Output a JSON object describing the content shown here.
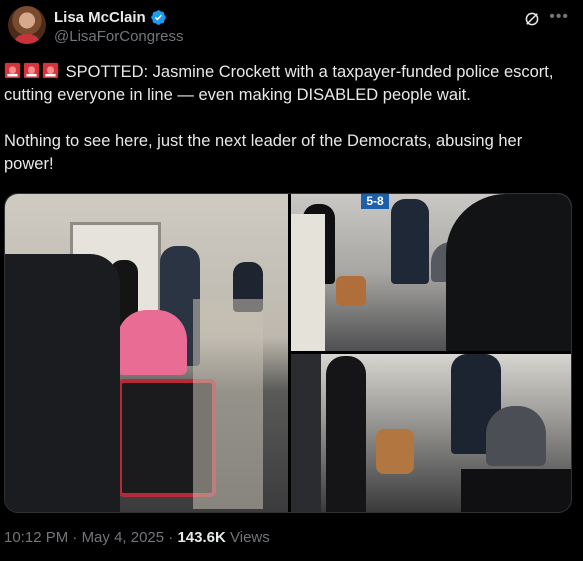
{
  "author": {
    "display_name": "Lisa McClain",
    "handle": "@LisaForCongress",
    "verified": true
  },
  "tweet": {
    "paragraph1": "SPOTTED: Jasmine Crockett with a taxpayer-funded police escort, cutting everyone in line — even making DISABLED people wait.",
    "paragraph2": "Nothing to see here, just the next leader of the Democrats, abusing her power!",
    "leading_emoji": [
      "rotating-light-icon",
      "rotating-light-icon",
      "rotating-light-icon"
    ]
  },
  "media": {
    "photo_count": 3,
    "gate_sign": "5-8"
  },
  "meta": {
    "time": "10:12 PM",
    "separator": "·",
    "date": "May 4, 2025",
    "views_count": "143.6K",
    "views_label": "Views"
  },
  "icons": {
    "verified": "verified-badge-icon",
    "grok": "grok-icon",
    "more": "more-options-icon"
  },
  "colors": {
    "background": "#000000",
    "text": "#e7e9ea",
    "secondary": "#71767b",
    "verified": "#1d9bf0"
  }
}
